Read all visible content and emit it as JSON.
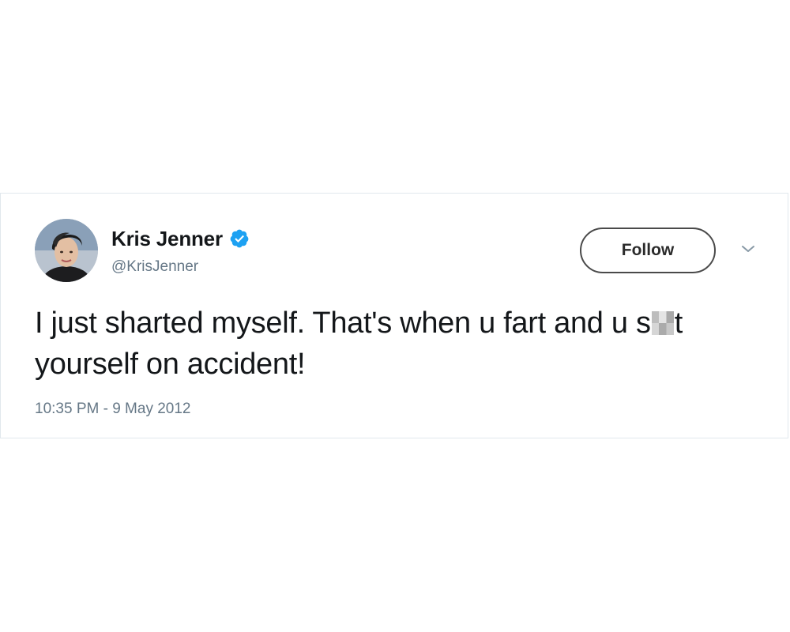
{
  "tweet": {
    "author": {
      "display_name": "Kris Jenner",
      "handle": "@KrisJenner",
      "verified": true,
      "verified_icon": "verified-badge-icon"
    },
    "follow_label": "Follow",
    "menu_icon": "chevron-down-icon",
    "text": {
      "before_censor": "I just sharted myself. That's when u fart and u s",
      "after_censor": "t yourself on accident!"
    },
    "timestamp": "10:35 PM - 9 May 2012"
  },
  "colors": {
    "verified_blue": "#1da1f2",
    "text_primary": "#14171a",
    "text_secondary": "#657786",
    "card_border": "#e1e8ed"
  }
}
